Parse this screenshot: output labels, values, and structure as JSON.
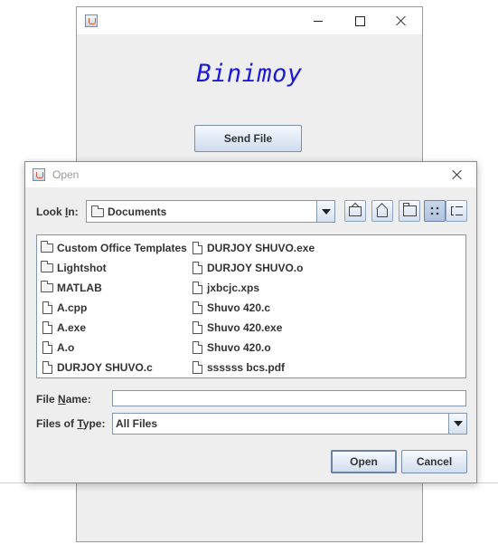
{
  "main_window": {
    "app_title": "Binimoy",
    "send_button_label": "Send File"
  },
  "dialog": {
    "title": "Open",
    "look_in": {
      "label_pre": "Look ",
      "label_mnemonic": "I",
      "label_post": "n:",
      "value": "Documents"
    },
    "toolbar": [
      {
        "name": "up-one-level-icon",
        "selected": false
      },
      {
        "name": "home-icon",
        "selected": false
      },
      {
        "name": "new-folder-icon",
        "selected": false
      },
      {
        "name": "list-view-icon",
        "selected": true
      },
      {
        "name": "details-view-icon",
        "selected": false
      }
    ],
    "files_column_1": [
      {
        "name": "Custom Office Templates",
        "type": "folder"
      },
      {
        "name": "Lightshot",
        "type": "folder"
      },
      {
        "name": "MATLAB",
        "type": "folder"
      },
      {
        "name": "A.cpp",
        "type": "file"
      },
      {
        "name": "A.exe",
        "type": "file"
      },
      {
        "name": "A.o",
        "type": "file"
      },
      {
        "name": "DURJOY SHUVO.c",
        "type": "file"
      }
    ],
    "files_column_2": [
      {
        "name": "DURJOY SHUVO.exe",
        "type": "file"
      },
      {
        "name": "DURJOY SHUVO.o",
        "type": "file"
      },
      {
        "name": "jxbcjc.xps",
        "type": "file"
      },
      {
        "name": "Shuvo 420.c",
        "type": "file"
      },
      {
        "name": "Shuvo 420.exe",
        "type": "file"
      },
      {
        "name": "Shuvo 420.o",
        "type": "file"
      },
      {
        "name": "ssssss bcs.pdf",
        "type": "file"
      }
    ],
    "file_name": {
      "label_pre": "File ",
      "label_mnemonic": "N",
      "label_post": "ame:",
      "value": ""
    },
    "files_of_type": {
      "label_pre": "Files of ",
      "label_mnemonic": "T",
      "label_post": "ype:",
      "value": "All Files"
    },
    "open_button_label": "Open",
    "cancel_button_label": "Cancel"
  }
}
